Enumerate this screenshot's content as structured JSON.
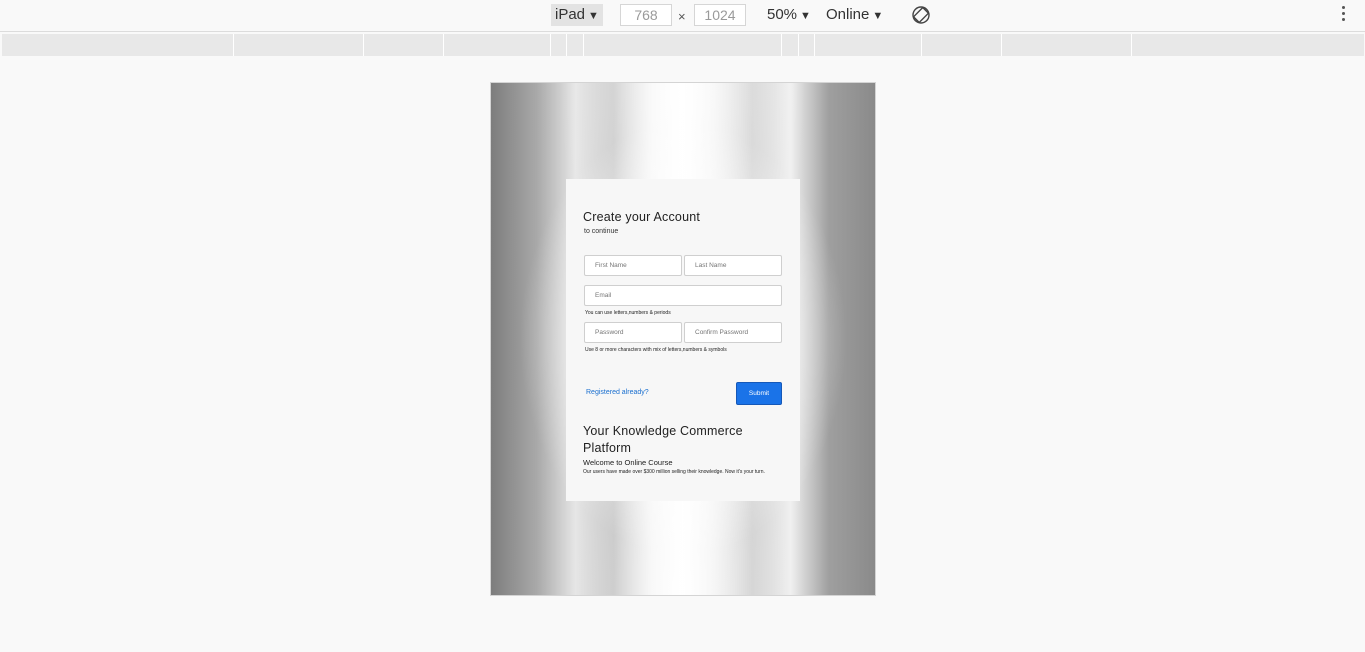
{
  "toolbar": {
    "device": "iPad",
    "width_value": "768",
    "height_value": "1024",
    "times": "×",
    "zoom": "50%",
    "network": "Online",
    "caret": "▼",
    "rotate_icon": "rotate-icon",
    "more_icon": "more-vertical-icon"
  },
  "form": {
    "title": "Create your Account",
    "subtitle": "to continue",
    "first_name_placeholder": "First Name",
    "last_name_placeholder": "Last Name",
    "email_placeholder": "Email",
    "email_hint": "You can use letters,numbers & periods",
    "password_placeholder": "Password",
    "confirm_password_placeholder": "Confirm Password",
    "password_hint": "Use 8 or more characters with mix of letters,numbers & symbols",
    "login_link": "Registered already?",
    "submit_label": "Submit"
  },
  "promo": {
    "title": "Your Knowledge Commerce Platform",
    "subtitle": "Welcome to Online Course",
    "body": "Our users have made over $300 million selling their knowledge. Now it's your turn."
  }
}
